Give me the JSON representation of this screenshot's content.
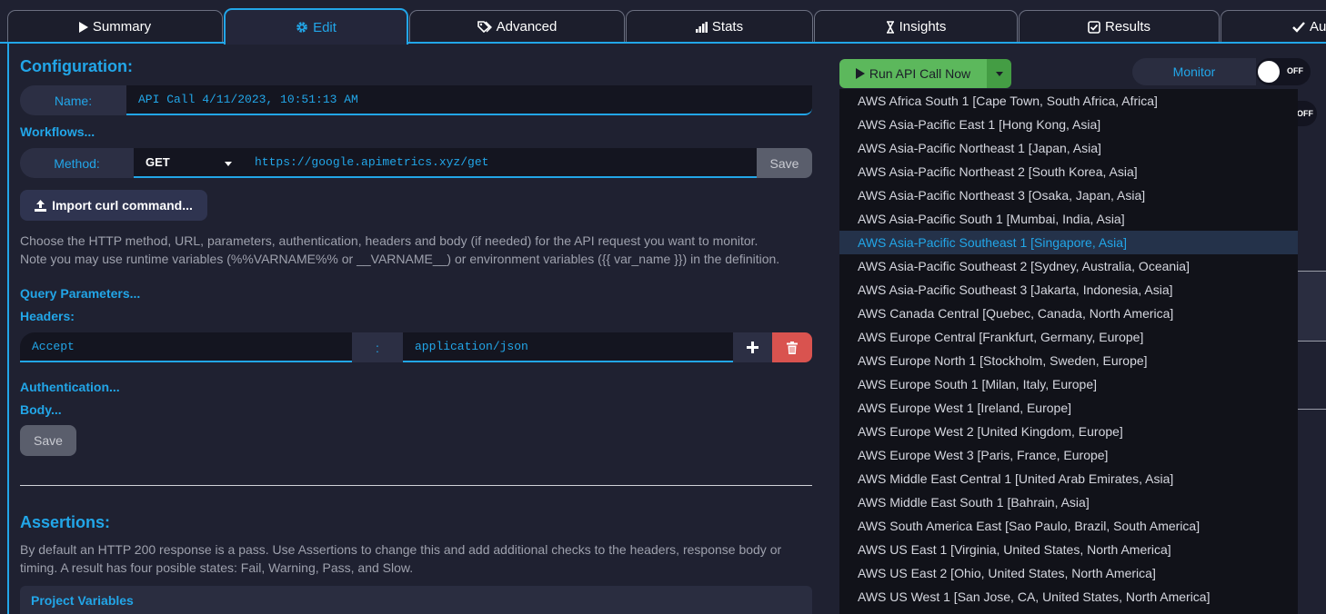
{
  "tabs": [
    {
      "label": "Summary",
      "icon": "play-icon"
    },
    {
      "label": "Edit",
      "icon": "gear-icon"
    },
    {
      "label": "Advanced",
      "icon": "tags-icon"
    },
    {
      "label": "Stats",
      "icon": "bar-chart-icon"
    },
    {
      "label": "Insights",
      "icon": "hourglass-icon"
    },
    {
      "label": "Results",
      "icon": "check-square-icon"
    },
    {
      "label": "Au",
      "icon": "check-icon"
    }
  ],
  "active_tab": "Edit",
  "config": {
    "heading": "Configuration:",
    "name_label": "Name:",
    "name_value": "API Call 4/11/2023, 10:51:13 AM",
    "workflows_link": "Workflows...",
    "method_label": "Method:",
    "method_value": "GET",
    "url_value": "https://google.apimetrics.xyz/get",
    "save_label": "Save",
    "import_curl_label": "Import curl command...",
    "help_line1": "Choose the HTTP method, URL, parameters, authentication, headers and body (if needed) for the API request you want to monitor.",
    "help_line2": "Note you may use runtime variables (%%VARNAME%% or __VARNAME__) or environment variables ({{ var_name }}) in the definition.",
    "query_params_link": "Query Parameters...",
    "headers_label": "Headers:",
    "header_key": "Accept",
    "header_sep": ":",
    "header_value": "application/json",
    "auth_link": "Authentication...",
    "body_link": "Body...",
    "save2_label": "Save"
  },
  "assertions": {
    "heading": "Assertions:",
    "text_line1": "By default an HTTP 200 response is a pass. Use Assertions to change this and add additional checks to the headers, response body or",
    "text_line2": "timing. A result has four posible states: Fail, Warning, Pass, and Slow.",
    "project_vars_label": "Project Variables"
  },
  "run": {
    "label": "Run API Call Now",
    "monitor_label": "Monitor",
    "toggle_label": "OFF",
    "toggle2_label": "OFF",
    "locations": [
      "AWS Africa South 1 [Cape Town, South Africa, Africa]",
      "AWS Asia-Pacific East 1 [Hong Kong, Asia]",
      "AWS Asia-Pacific Northeast 1 [Japan, Asia]",
      "AWS Asia-Pacific Northeast 2 [South Korea, Asia]",
      "AWS Asia-Pacific Northeast 3 [Osaka, Japan, Asia]",
      "AWS Asia-Pacific South 1 [Mumbai, India, Asia]",
      "AWS Asia-Pacific Southeast 1 [Singapore, Asia]",
      "AWS Asia-Pacific Southeast 2 [Sydney, Australia, Oceania]",
      "AWS Asia-Pacific Southeast 3 [Jakarta, Indonesia, Asia]",
      "AWS Canada Central [Quebec, Canada, North America]",
      "AWS Europe Central [Frankfurt, Germany, Europe]",
      "AWS Europe North 1 [Stockholm, Sweden, Europe]",
      "AWS Europe South 1 [Milan, Italy, Europe]",
      "AWS Europe West 1 [Ireland, Europe]",
      "AWS Europe West 2 [United Kingdom, Europe]",
      "AWS Europe West 3 [Paris, France, Europe]",
      "AWS Middle East Central 1 [United Arab Emirates, Asia]",
      "AWS Middle East South 1 [Bahrain, Asia]",
      "AWS South America East [Sao Paulo, Brazil, South America]",
      "AWS US East 1 [Virginia, United States, North America]",
      "AWS US East 2 [Ohio, United States, North America]",
      "AWS US West 1 [San Jose, CA, United States, North America]"
    ],
    "selected_location": "AWS Asia-Pacific Southeast 1 [Singapore, Asia]"
  },
  "colors": {
    "accent": "#22a6e8",
    "background": "#1f2131",
    "run_button": "#5cb85c",
    "delete_button": "#d9534f"
  }
}
